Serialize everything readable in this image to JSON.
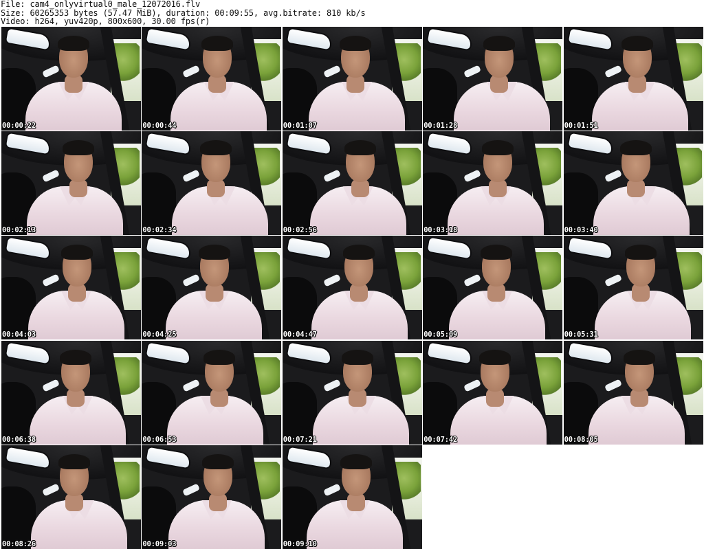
{
  "header": {
    "file_line": "File: cam4_onlyvirtual0_male_12072016.flv",
    "size_line": "Size: 60265353 bytes (57.47 MiB), duration: 00:09:55, avg.bitrate: 810 kb/s",
    "video_line": "Video: h264, yuv420p, 800x600, 30.00 fps(r)"
  },
  "thumbnails": [
    {
      "timecode": "00:00:22"
    },
    {
      "timecode": "00:00:44"
    },
    {
      "timecode": "00:01:07"
    },
    {
      "timecode": "00:01:28"
    },
    {
      "timecode": "00:01:51"
    },
    {
      "timecode": "00:02:13"
    },
    {
      "timecode": "00:02:34"
    },
    {
      "timecode": "00:02:56"
    },
    {
      "timecode": "00:03:18"
    },
    {
      "timecode": "00:03:40"
    },
    {
      "timecode": "00:04:03"
    },
    {
      "timecode": "00:04:25"
    },
    {
      "timecode": "00:04:47"
    },
    {
      "timecode": "00:05:09"
    },
    {
      "timecode": "00:05:31"
    },
    {
      "timecode": "00:06:38"
    },
    {
      "timecode": "00:06:53"
    },
    {
      "timecode": "00:07:21"
    },
    {
      "timecode": "00:07:42"
    },
    {
      "timecode": "00:08:05"
    },
    {
      "timecode": "00:08:26"
    },
    {
      "timecode": "00:09:03"
    },
    {
      "timecode": "00:09:10"
    }
  ]
}
